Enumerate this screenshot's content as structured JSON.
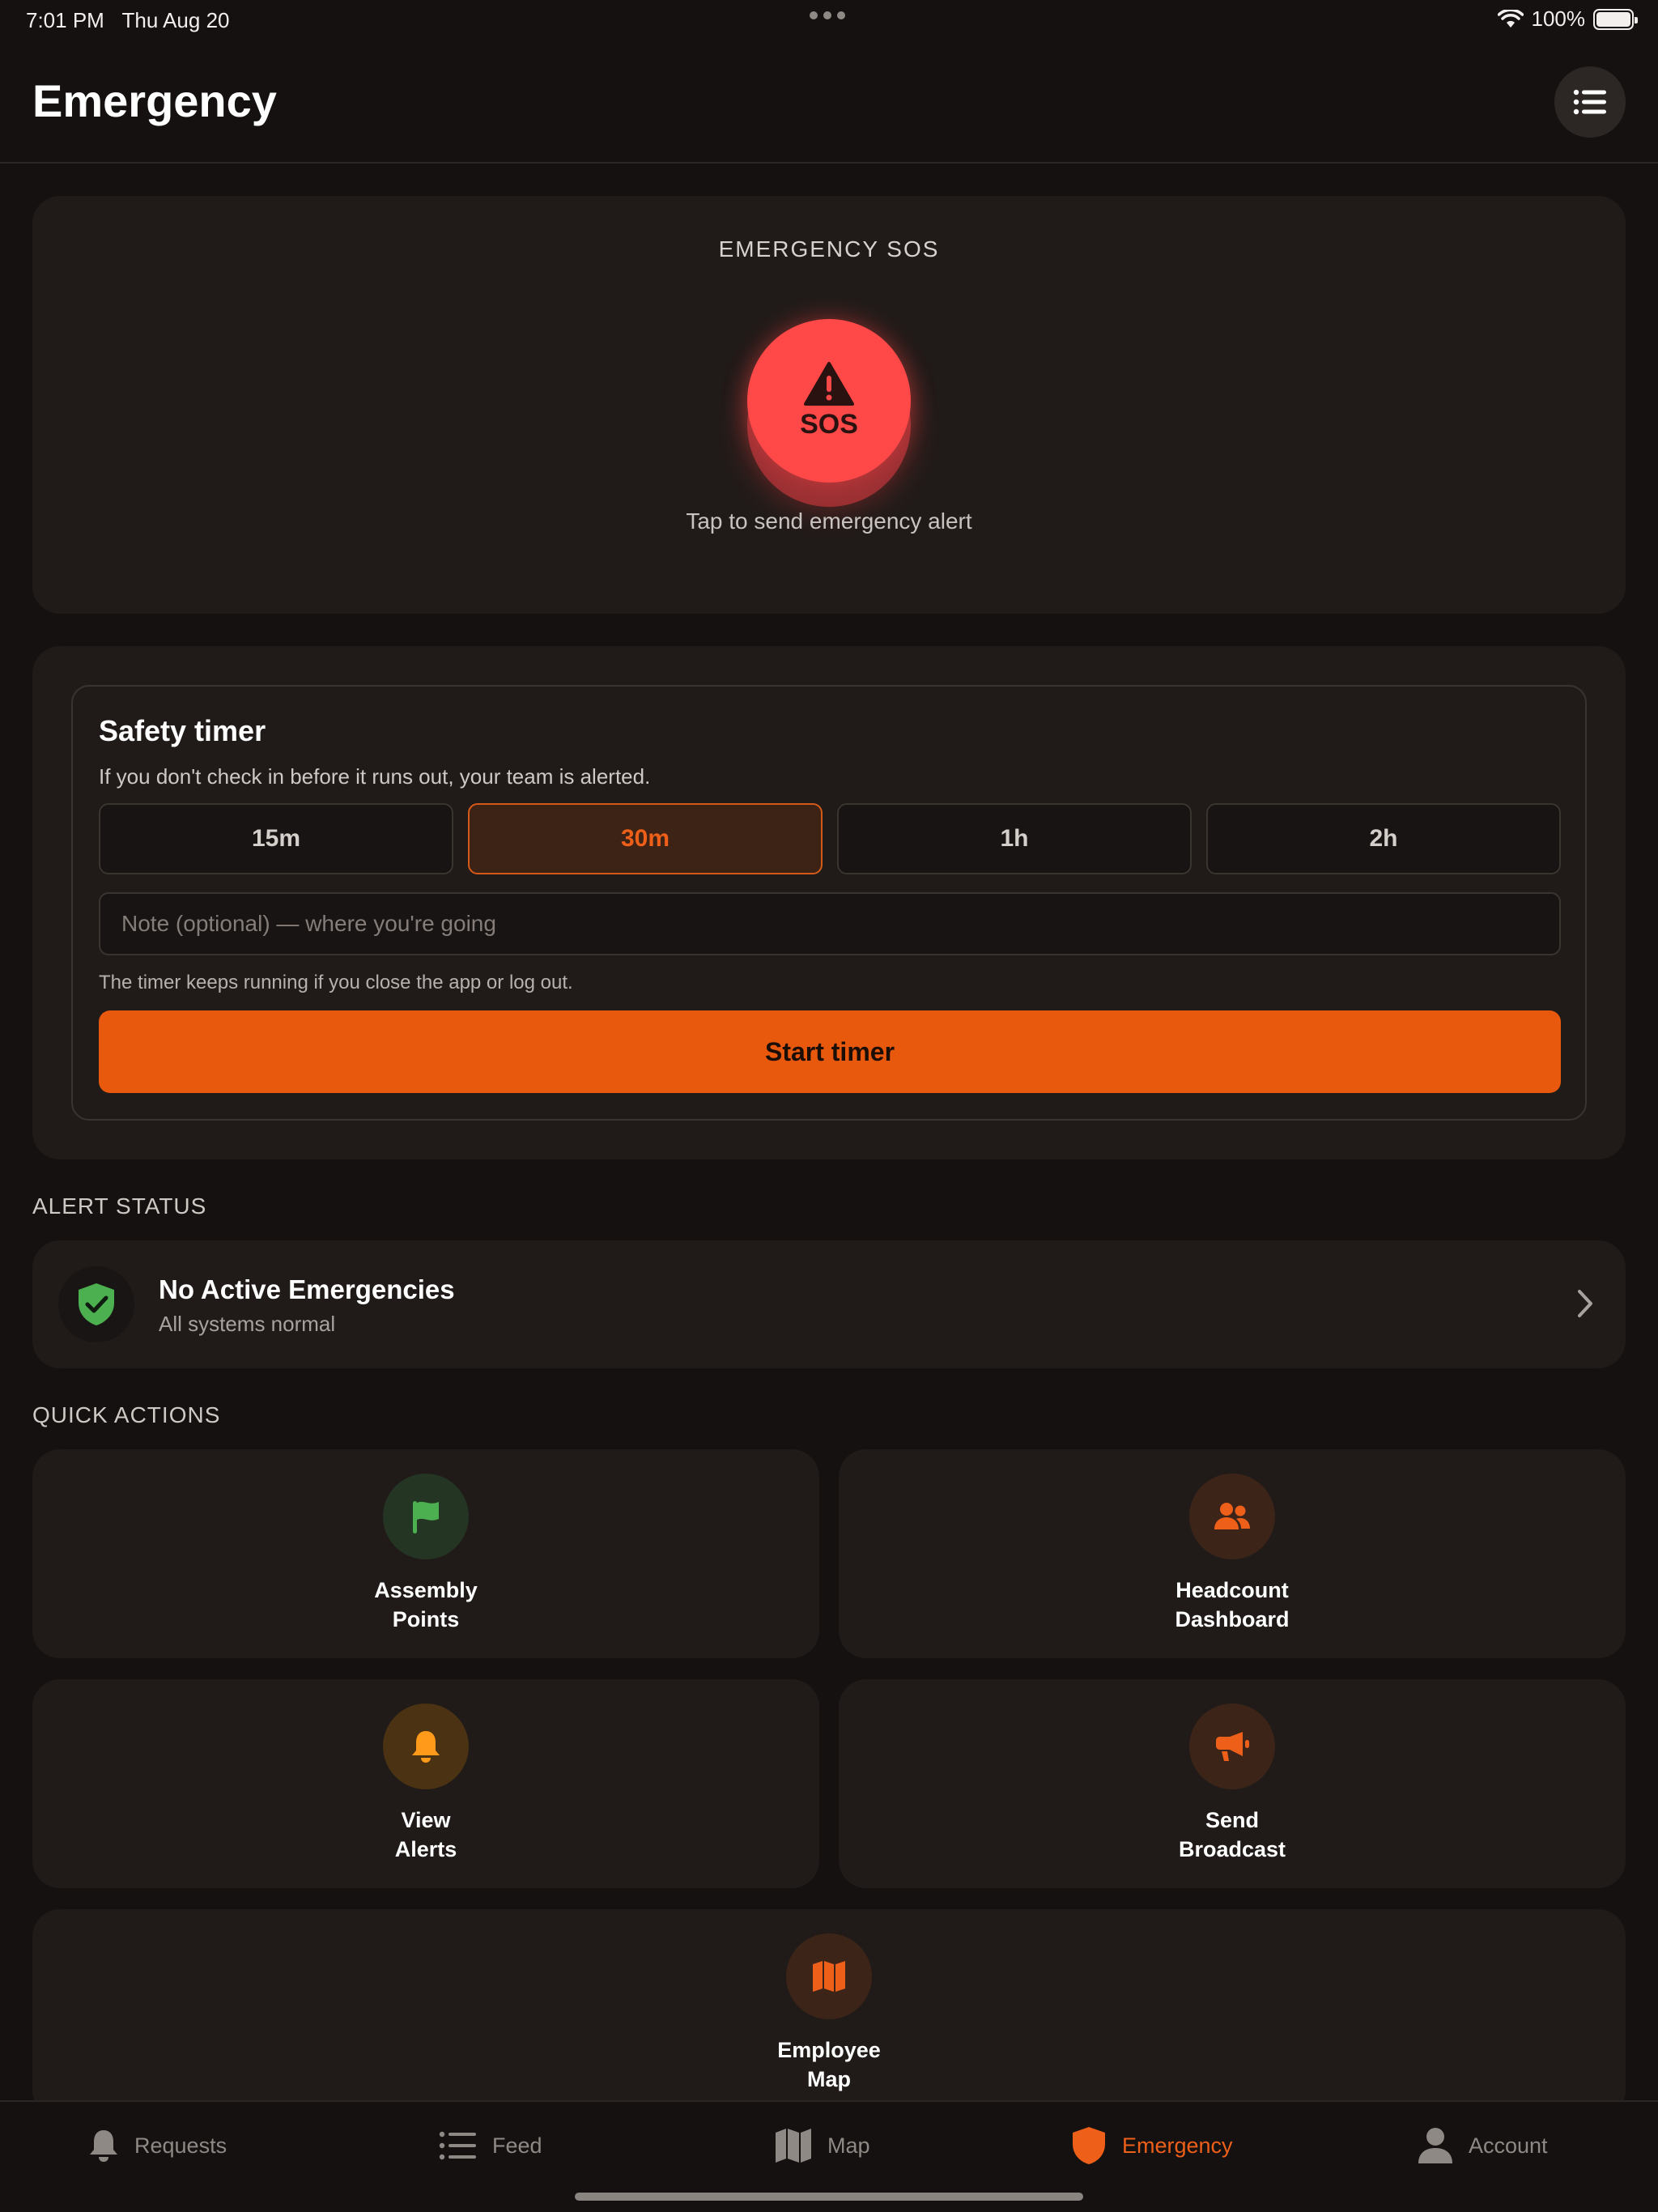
{
  "status_bar": {
    "time": "7:01 PM",
    "date": "Thu Aug 20",
    "battery": "100%",
    "icons": [
      "wifi-icon",
      "battery-icon"
    ]
  },
  "header": {
    "title": "Emergency",
    "menu_icon": "list-icon"
  },
  "sos": {
    "title": "EMERGENCY SOS",
    "button_label": "SOS",
    "button_icon": "warning-icon",
    "hint": "Tap to send emergency alert",
    "color": "#ff4848"
  },
  "safety_timer": {
    "title": "Safety timer",
    "description": "If you don't check in before it runs out, your team is alerted.",
    "durations": [
      {
        "label": "15m",
        "selected": false
      },
      {
        "label": "30m",
        "selected": true
      },
      {
        "label": "1h",
        "selected": false
      },
      {
        "label": "2h",
        "selected": false
      }
    ],
    "note_value": "",
    "note_placeholder": "Note (optional) — where you're going",
    "footnote": "The timer keeps running if you close the app or log out.",
    "start_label": "Start timer",
    "accent": "#e8580d"
  },
  "alert_status": {
    "section_label": "ALERT STATUS",
    "title": "No Active Emergencies",
    "subtitle": "All systems normal",
    "icon": "shield-check-icon",
    "status_color": "#4caf50"
  },
  "quick_actions": {
    "section_label": "QUICK ACTIONS",
    "items": [
      {
        "line1": "Assembly",
        "line2": "Points",
        "icon": "flag-icon",
        "color": "#4caf50"
      },
      {
        "line1": "Headcount",
        "line2": "Dashboard",
        "icon": "people-icon",
        "color": "#ee5f1a"
      },
      {
        "line1": "View",
        "line2": "Alerts",
        "icon": "bell-icon",
        "color": "#ff9a1a"
      },
      {
        "line1": "Send",
        "line2": "Broadcast",
        "icon": "megaphone-icon",
        "color": "#ee5f1a"
      },
      {
        "line1": "Employee",
        "line2": "Map",
        "icon": "map-icon",
        "color": "#ee5f1a"
      }
    ]
  },
  "tab_bar": {
    "items": [
      {
        "label": "Requests",
        "icon": "bell-icon",
        "active": false
      },
      {
        "label": "Feed",
        "icon": "list-icon",
        "active": false
      },
      {
        "label": "Map",
        "icon": "map-icon",
        "active": false
      },
      {
        "label": "Emergency",
        "icon": "shield-icon",
        "active": true
      },
      {
        "label": "Account",
        "icon": "person-icon",
        "active": false
      }
    ]
  }
}
